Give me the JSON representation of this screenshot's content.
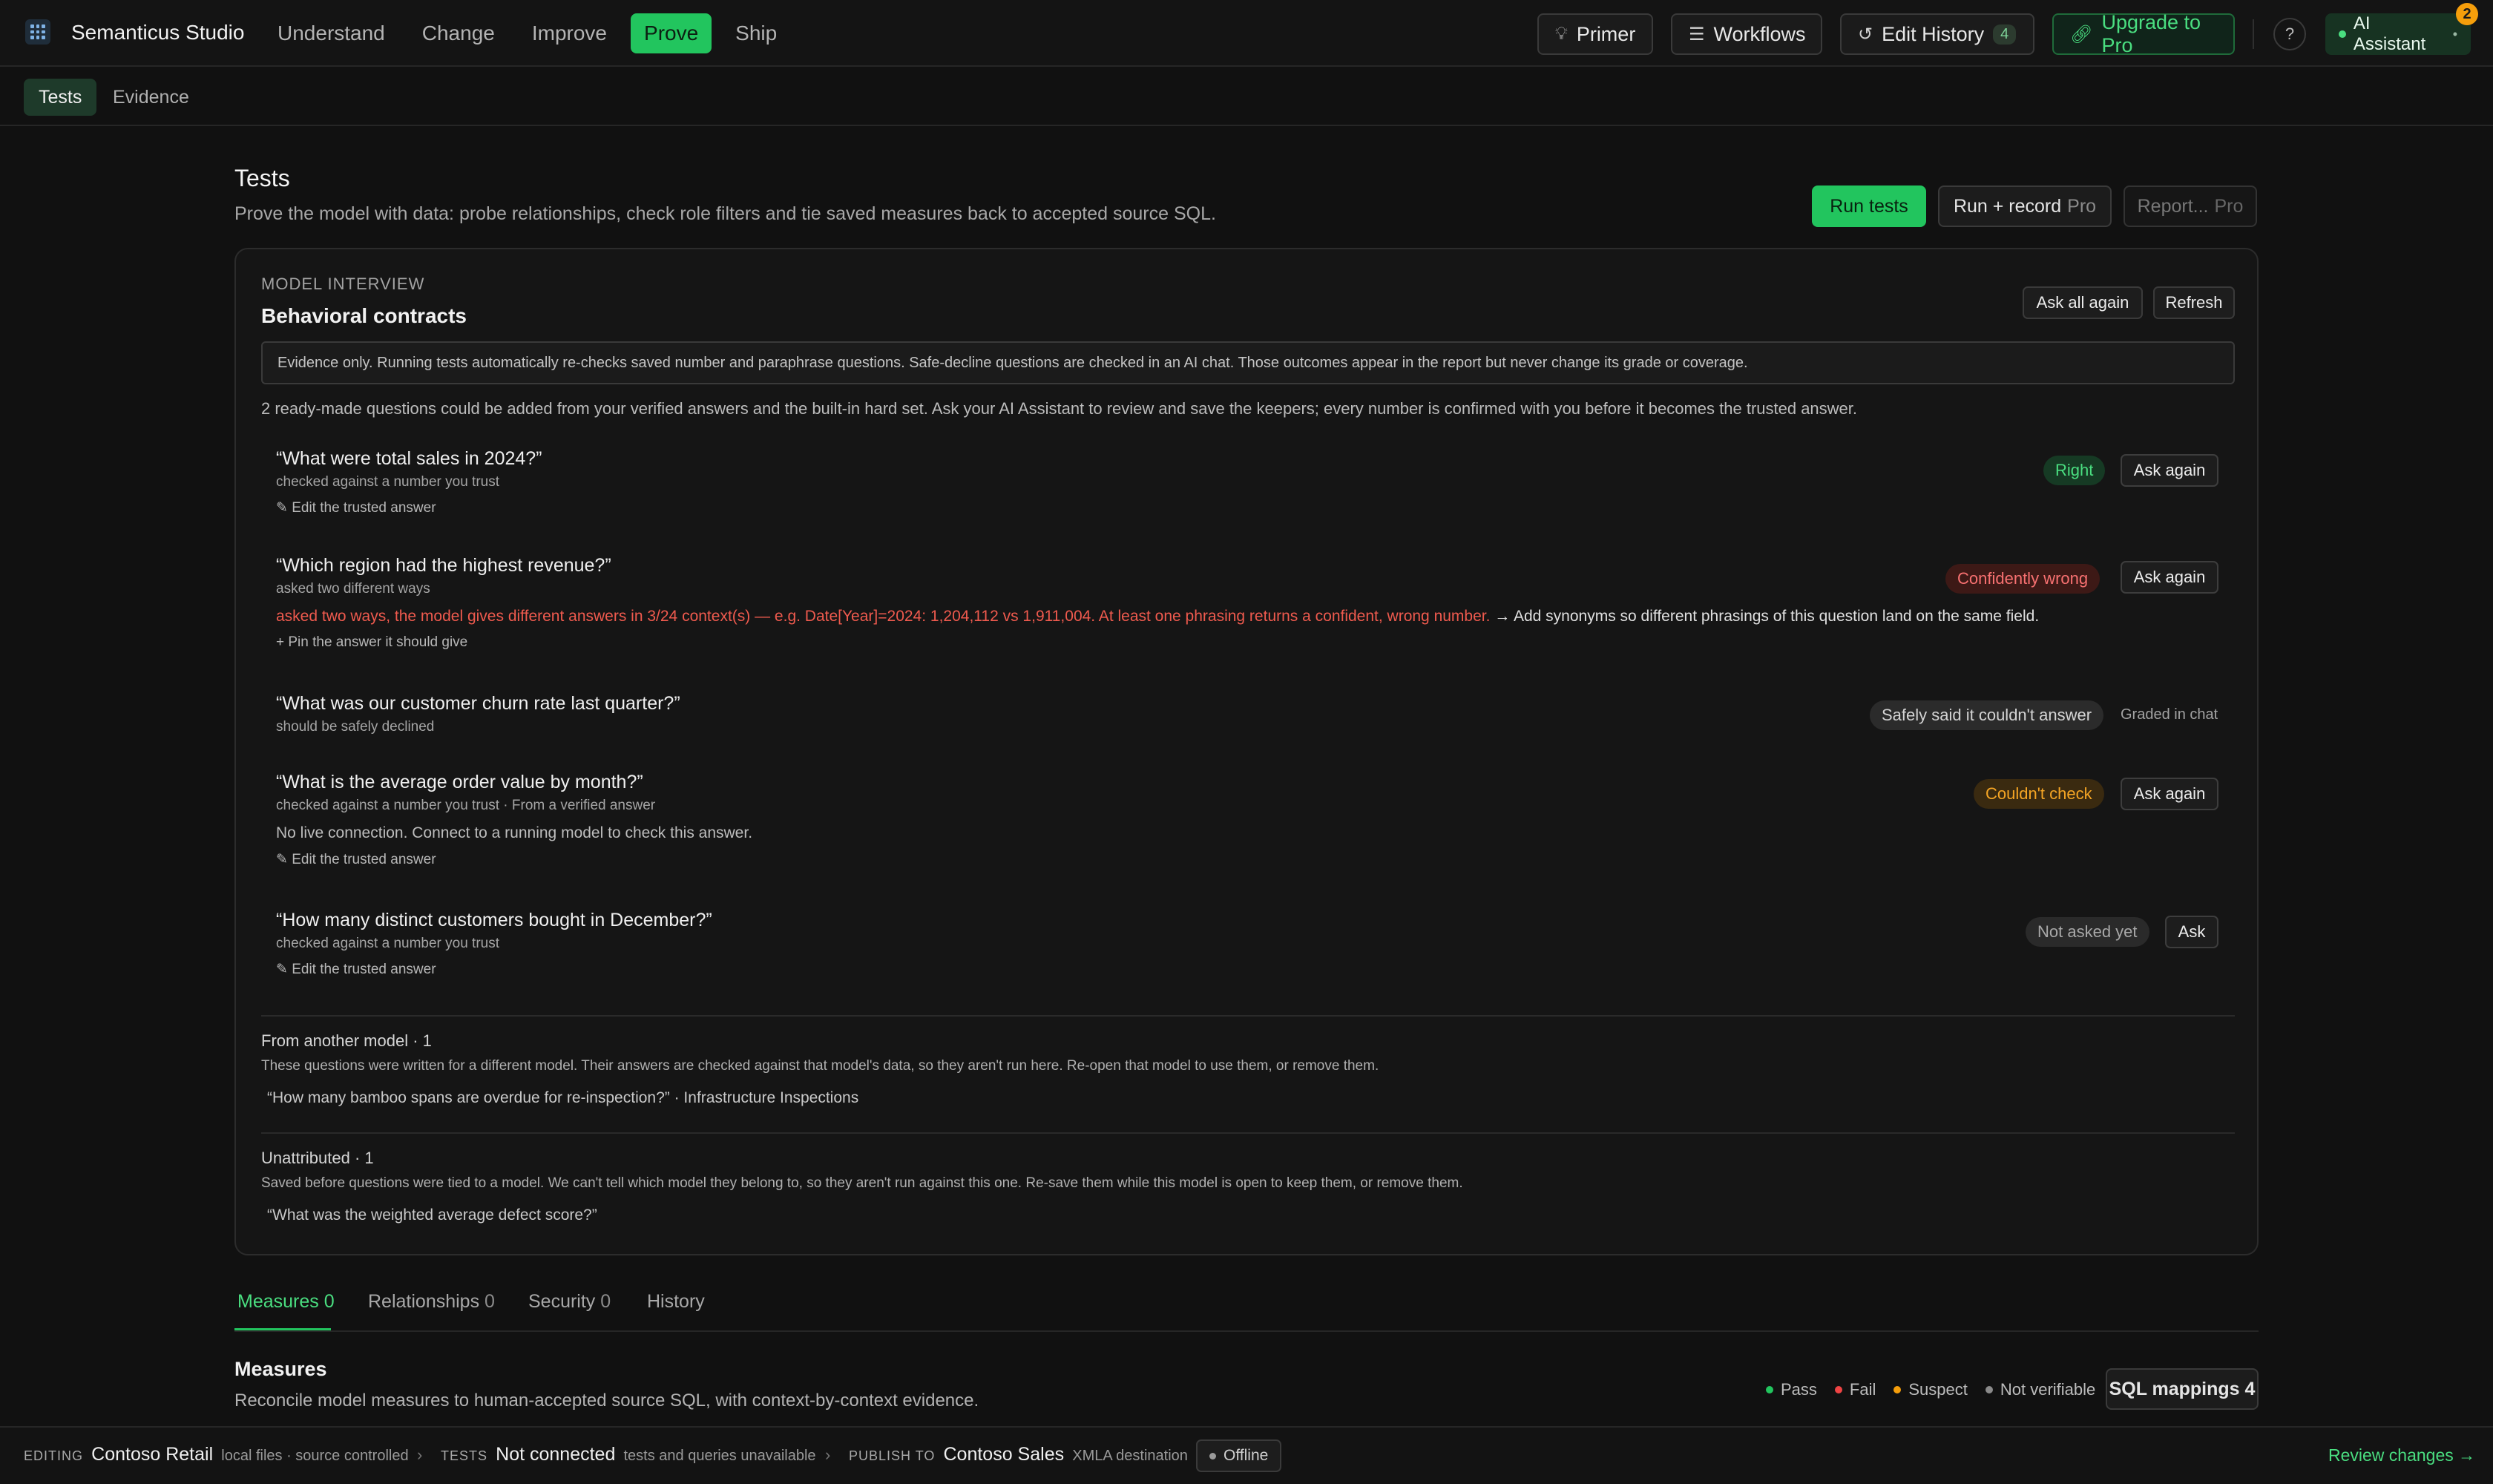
{
  "app": {
    "title": "Semanticus Studio"
  },
  "nav": [
    "Understand",
    "Change",
    "Improve",
    "Prove",
    "Ship"
  ],
  "toolbar": {
    "primer": "Primer",
    "workflows": "Workflows",
    "edit_history": "Edit History",
    "edit_history_count": "4",
    "upgrade": "Upgrade to Pro",
    "help": "?",
    "ai_assistant": "AI Assistant",
    "ai_notifications": "2"
  },
  "subtabs": [
    "Tests",
    "Evidence"
  ],
  "page": {
    "title": "Tests",
    "subtitle": "Prove the model with data: probe relationships, check role filters and tie saved measures back to accepted source SQL.",
    "run_tests": "Run tests",
    "run_record": "Run + record",
    "report": "Report...",
    "pro": "Pro"
  },
  "interview": {
    "eyebrow": "MODEL INTERVIEW",
    "title": "Behavioral contracts",
    "ask_all": "Ask all again",
    "refresh": "Refresh",
    "notice": "Evidence only. Running tests automatically re-checks saved number and paraphrase questions. Safe-decline questions are checked in an AI chat. Those outcomes appear in the report but never change its grade or coverage.",
    "intro": "2 ready-made questions could be added from your verified answers and the built-in hard set. Ask your AI Assistant to review and save the keepers; every number is confirmed with you before it becomes the trusted answer.",
    "questions": [
      {
        "text": "“What were total sales in 2024?”",
        "sub": "checked against a number you trust",
        "link": "✎ Edit the trusted answer",
        "status": "Right",
        "action": "Ask again"
      },
      {
        "text": "“Which region had the highest revenue?”",
        "sub": "asked two different ways",
        "detail_error": "asked two ways, the model gives different answers in 3/24 context(s) — e.g. Date[Year]=2024: 1,204,112 vs 1,911,004. At least one phrasing returns a confident, wrong number.",
        "detail_fix": " → Add synonyms so different phrasings of this question land on the same field.",
        "link": "+ Pin the answer it should give",
        "status": "Confidently wrong",
        "action": "Ask again"
      },
      {
        "text": "“What was our customer churn rate last quarter?”",
        "sub": "should be safely declined",
        "status": "Safely said it couldn't answer",
        "graded": "Graded in chat"
      },
      {
        "text": "“What is the average order value by month?”",
        "sub": "checked against a number you trust · From a verified answer",
        "detail": "No live connection. Connect to a running model to check this answer.",
        "link": "✎ Edit the trusted answer",
        "status": "Couldn't check",
        "action": "Ask again"
      },
      {
        "text": "“How many distinct customers bought in December?”",
        "sub": "checked against a number you trust",
        "link": "✎ Edit the trusted answer",
        "status": "Not asked yet",
        "action": "Ask"
      }
    ],
    "other_model": {
      "title": "From another model · 1",
      "desc": "These questions were written for a different model. Their answers are checked against that model's data, so they aren't run here. Re-open that model to use them, or remove them.",
      "item": "“How many bamboo spans are overdue for re-inspection?” · Infrastructure Inspections"
    },
    "unattributed": {
      "title": "Unattributed · 1",
      "desc": "Saved before questions were tied to a model. We can't tell which model they belong to, so they aren't run against this one. Re-save them while this model is open to keep them, or remove them.",
      "item": "“What was the weighted average defect score?”"
    }
  },
  "lower_tabs": [
    {
      "label": "Measures",
      "count": "0"
    },
    {
      "label": "Relationships",
      "count": "0"
    },
    {
      "label": "Security",
      "count": "0"
    },
    {
      "label": "History",
      "count": ""
    }
  ],
  "measures": {
    "title": "Measures",
    "subtitle": "Reconcile model measures to human-accepted source SQL, with context-by-context evidence.",
    "legend": [
      "Pass",
      "Fail",
      "Suspect",
      "Not verifiable"
    ],
    "sql_mappings": "SQL mappings 4"
  },
  "statusbar": {
    "editing_label": "EDITING",
    "editing_value": "Contoso Retail",
    "editing_note": "local files · source controlled",
    "tests_label": "TESTS",
    "tests_value": "Not connected",
    "tests_note": "tests and queries unavailable",
    "publish_label": "PUBLISH TO",
    "publish_value": "Contoso Sales",
    "publish_note": "XMLA destination",
    "offline": "Offline",
    "review": "Review changes →"
  },
  "colors": {
    "accent": "#22c55e",
    "fail": "#ef4444",
    "suspect": "#f59e0b",
    "neutral": "#8a8a8a"
  }
}
